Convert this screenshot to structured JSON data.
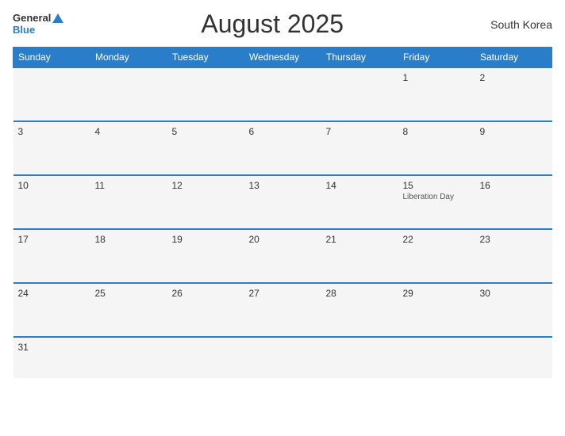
{
  "header": {
    "logo_general": "General",
    "logo_blue": "Blue",
    "title": "August 2025",
    "country": "South Korea"
  },
  "days_of_week": [
    "Sunday",
    "Monday",
    "Tuesday",
    "Wednesday",
    "Thursday",
    "Friday",
    "Saturday"
  ],
  "weeks": [
    [
      {
        "day": "",
        "empty": true
      },
      {
        "day": "",
        "empty": true
      },
      {
        "day": "",
        "empty": true
      },
      {
        "day": "",
        "empty": true
      },
      {
        "day": "",
        "empty": true
      },
      {
        "day": "1",
        "empty": false,
        "event": ""
      },
      {
        "day": "2",
        "empty": false,
        "event": ""
      }
    ],
    [
      {
        "day": "3",
        "empty": false,
        "event": ""
      },
      {
        "day": "4",
        "empty": false,
        "event": ""
      },
      {
        "day": "5",
        "empty": false,
        "event": ""
      },
      {
        "day": "6",
        "empty": false,
        "event": ""
      },
      {
        "day": "7",
        "empty": false,
        "event": ""
      },
      {
        "day": "8",
        "empty": false,
        "event": ""
      },
      {
        "day": "9",
        "empty": false,
        "event": ""
      }
    ],
    [
      {
        "day": "10",
        "empty": false,
        "event": ""
      },
      {
        "day": "11",
        "empty": false,
        "event": ""
      },
      {
        "day": "12",
        "empty": false,
        "event": ""
      },
      {
        "day": "13",
        "empty": false,
        "event": ""
      },
      {
        "day": "14",
        "empty": false,
        "event": ""
      },
      {
        "day": "15",
        "empty": false,
        "event": "Liberation Day"
      },
      {
        "day": "16",
        "empty": false,
        "event": ""
      }
    ],
    [
      {
        "day": "17",
        "empty": false,
        "event": ""
      },
      {
        "day": "18",
        "empty": false,
        "event": ""
      },
      {
        "day": "19",
        "empty": false,
        "event": ""
      },
      {
        "day": "20",
        "empty": false,
        "event": ""
      },
      {
        "day": "21",
        "empty": false,
        "event": ""
      },
      {
        "day": "22",
        "empty": false,
        "event": ""
      },
      {
        "day": "23",
        "empty": false,
        "event": ""
      }
    ],
    [
      {
        "day": "24",
        "empty": false,
        "event": ""
      },
      {
        "day": "25",
        "empty": false,
        "event": ""
      },
      {
        "day": "26",
        "empty": false,
        "event": ""
      },
      {
        "day": "27",
        "empty": false,
        "event": ""
      },
      {
        "day": "28",
        "empty": false,
        "event": ""
      },
      {
        "day": "29",
        "empty": false,
        "event": ""
      },
      {
        "day": "30",
        "empty": false,
        "event": ""
      }
    ],
    [
      {
        "day": "31",
        "empty": false,
        "event": ""
      },
      {
        "day": "",
        "empty": true
      },
      {
        "day": "",
        "empty": true
      },
      {
        "day": "",
        "empty": true
      },
      {
        "day": "",
        "empty": true
      },
      {
        "day": "",
        "empty": true
      },
      {
        "day": "",
        "empty": true
      }
    ]
  ]
}
